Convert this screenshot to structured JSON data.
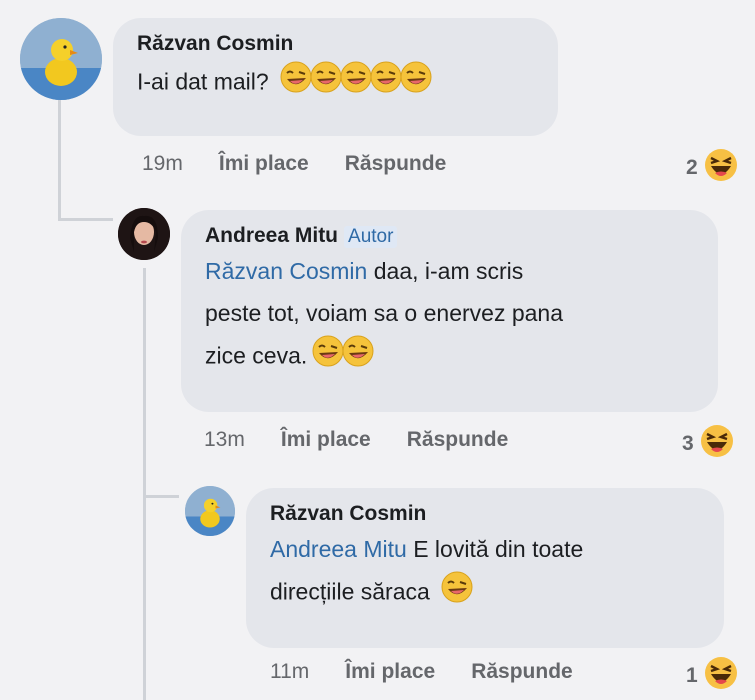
{
  "comments": [
    {
      "author": "Răzvan Cosmin",
      "text": "I-ai dat mail?",
      "emoji_count": 5,
      "time": "19m",
      "like_label": "Îmi place",
      "reply_label": "Răspunde",
      "reaction_count": "2"
    },
    {
      "author": "Andreea Mitu",
      "badge": "Autor",
      "mention": "Răzvan Cosmin",
      "line1": "daa, i-am scris",
      "line2": "peste tot, voiam sa o enervez pana",
      "line3": "zice ceva.",
      "emoji_count": 2,
      "time": "13m",
      "like_label": "Îmi place",
      "reply_label": "Răspunde",
      "reaction_count": "3"
    },
    {
      "author": "Răzvan Cosmin",
      "mention": "Andreea Mitu",
      "line1": "E lovită din toate",
      "line2": "direcțiile săraca",
      "emoji_count": 1,
      "time": "11m",
      "like_label": "Îmi place",
      "reply_label": "Răspunde",
      "reaction_count": "1"
    }
  ],
  "icons": {
    "text_emoji": "laughing-wink-emoji-icon",
    "reaction": "haha-reaction-icon"
  },
  "colors": {
    "bubble": "#e4e6eb",
    "mention": "#2f6aa6",
    "meta": "#65676b"
  }
}
